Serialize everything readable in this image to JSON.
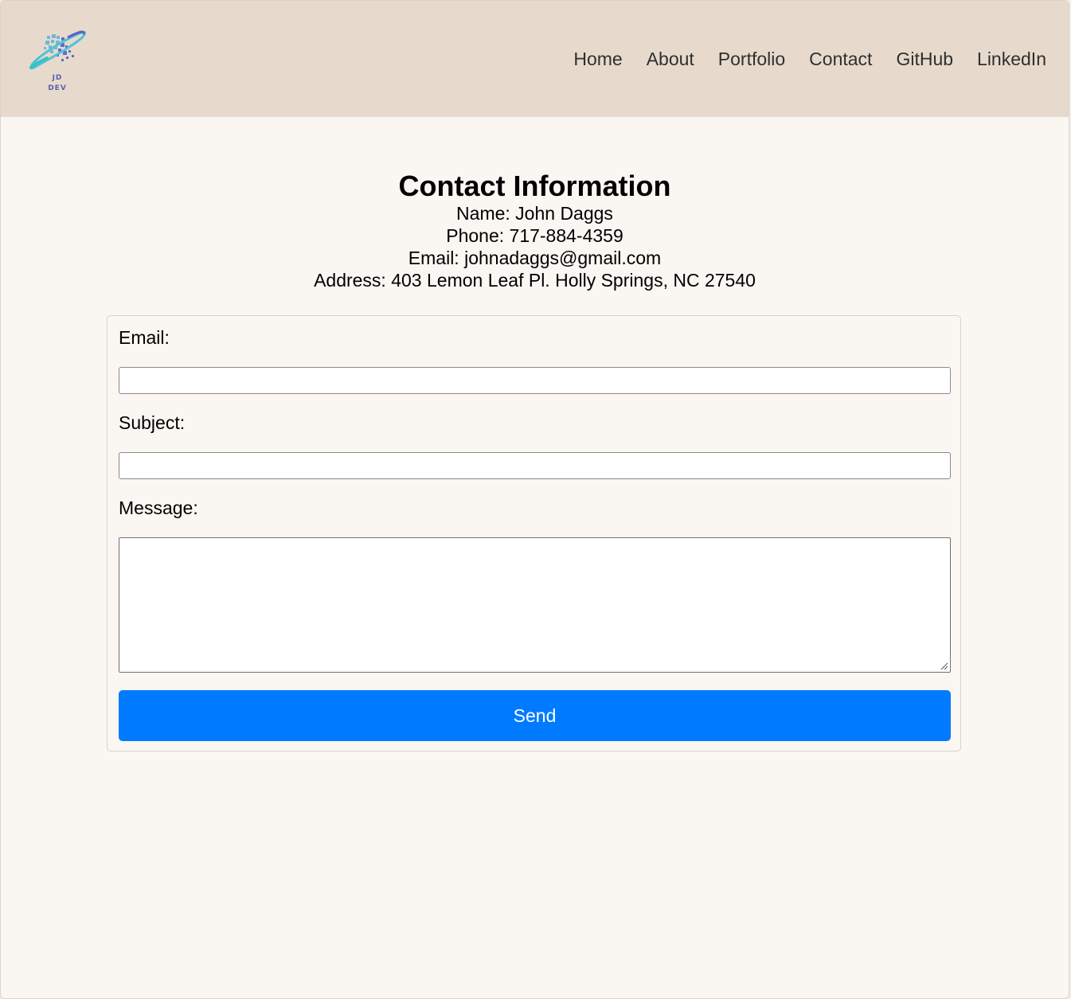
{
  "header": {
    "logo_text_line1": "JD",
    "logo_text_line2": "DEV",
    "nav": [
      "Home",
      "About",
      "Portfolio",
      "Contact",
      "GitHub",
      "LinkedIn"
    ]
  },
  "contact": {
    "title": "Contact Information",
    "name": "Name: John Daggs",
    "phone": "Phone: 717-884-4359",
    "email": "Email: johnadaggs@gmail.com",
    "address": "Address: 403 Lemon Leaf Pl. Holly Springs, NC 27540"
  },
  "form": {
    "email_label": "Email:",
    "email_value": "",
    "subject_label": "Subject:",
    "subject_value": "",
    "message_label": "Message:",
    "message_value": "",
    "send_label": "Send"
  },
  "colors": {
    "header_bg": "#e7dacd",
    "page_bg": "#faf6f2",
    "button_bg": "#007bff",
    "logo_accent": "#5a5fb0"
  },
  "icons": {
    "logo": "jd-dev-planet-logo",
    "resize": "textarea-resize-grip-icon"
  }
}
